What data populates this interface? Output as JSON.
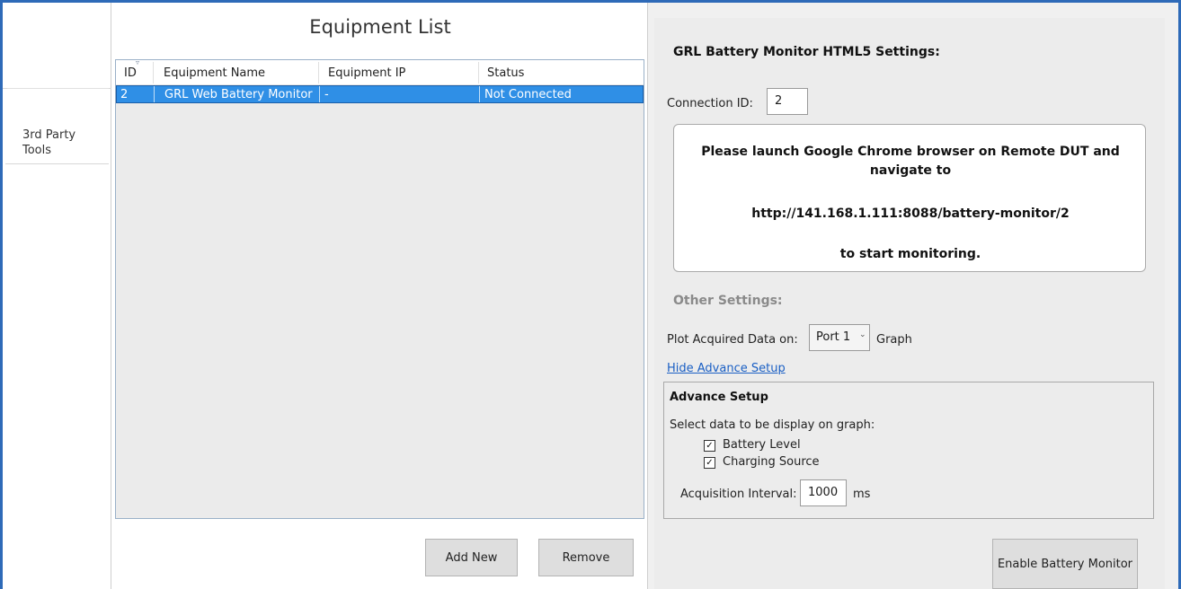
{
  "nav": {
    "items": [
      {
        "label": "3rd Party Tools"
      }
    ]
  },
  "equipment": {
    "title": "Equipment List",
    "columns": [
      "ID",
      "Equipment Name",
      "Equipment IP",
      "Status"
    ],
    "rows": [
      {
        "id": "2",
        "name": "GRL Web Battery Monitor",
        "ip": "-",
        "status": "Not Connected"
      }
    ],
    "add_label": "Add New",
    "remove_label": "Remove"
  },
  "settings": {
    "title": "GRL Battery Monitor HTML5 Settings:",
    "connection_label": "Connection ID:",
    "connection_value": "2",
    "instruction_line1": "Please launch Google Chrome browser on Remote DUT and",
    "instruction_line2": "navigate to",
    "url": "http://141.168.1.111:8088/battery-monitor/2",
    "instruction_end": "to start monitoring.",
    "other_title": "Other Settings:",
    "plot_label": "Plot Acquired Data on:",
    "port_selected": "Port 1",
    "graph_label": "Graph",
    "hide_link": "Hide Advance Setup"
  },
  "advance": {
    "title": "Advance Setup",
    "description": "Select data to be display on graph:",
    "options": [
      {
        "label": "Battery Level",
        "checked": true
      },
      {
        "label": "Charging Source",
        "checked": true
      }
    ],
    "interval_label": "Acquisition Interval:",
    "interval_value": "1000",
    "interval_unit": "ms"
  },
  "actions": {
    "enable_label": "Enable Battery Monitor"
  },
  "colors": {
    "accent": "#2e6ab8",
    "selection": "#2f8fe6",
    "link": "#1a5fc4"
  }
}
